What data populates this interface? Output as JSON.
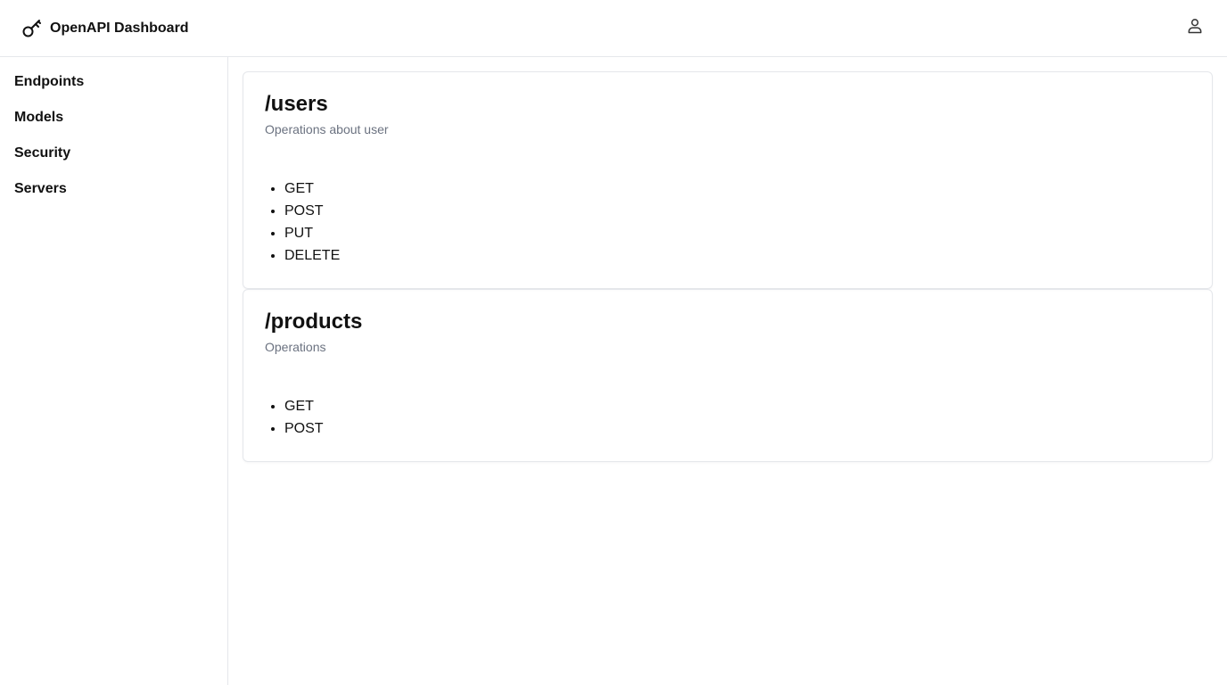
{
  "header": {
    "title": "OpenAPI Dashboard",
    "logo_icon": "key-icon",
    "user_icon": "user-icon"
  },
  "sidebar": {
    "items": [
      {
        "label": "Endpoints"
      },
      {
        "label": "Models"
      },
      {
        "label": "Security"
      },
      {
        "label": "Servers"
      }
    ]
  },
  "endpoints": [
    {
      "path": "/users",
      "description": "Operations about user",
      "methods": [
        "GET",
        "POST",
        "PUT",
        "DELETE"
      ]
    },
    {
      "path": "/products",
      "description": "Operations",
      "methods": [
        "GET",
        "POST"
      ]
    }
  ],
  "colors": {
    "border": "#e5e7eb",
    "muted_text": "#6b7280",
    "text": "#111111"
  }
}
